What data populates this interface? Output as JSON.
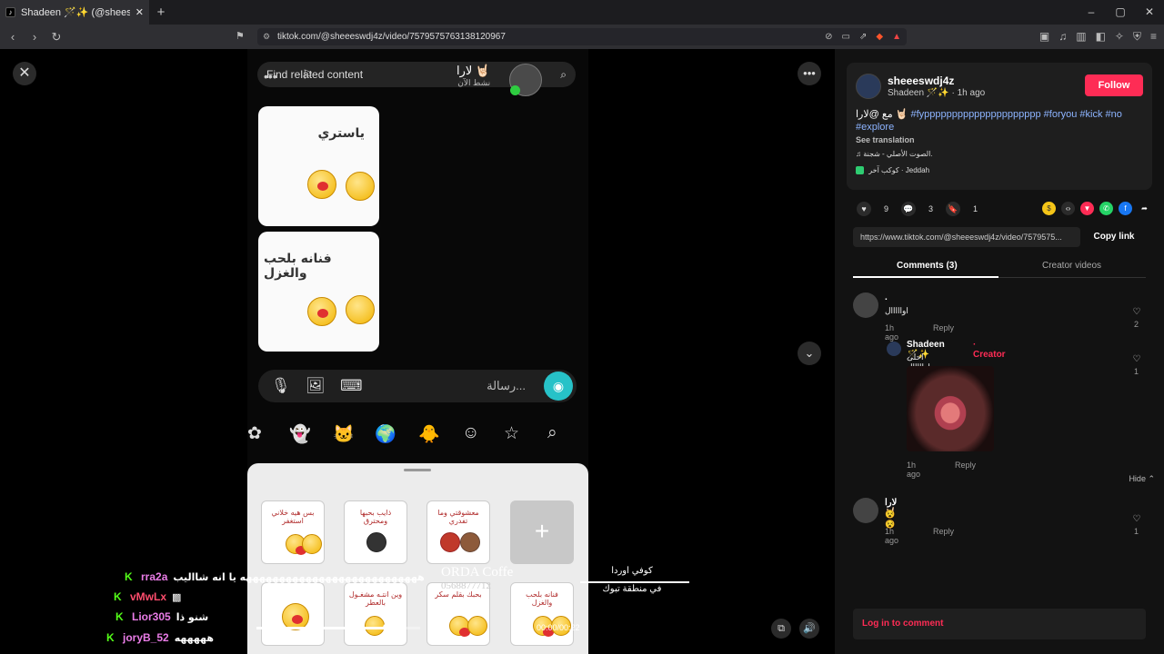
{
  "browser": {
    "tab_title": "Shadeen 🪄✨ (@sheeswd",
    "url": "tiktok.com/@sheeeswdj4z/video/7579575763138120967"
  },
  "video": {
    "search_placeholder": "Find related content",
    "chat_name": "لارا 🤘🏻",
    "chat_status": "نشط الآن",
    "stickers": [
      {
        "text": "ياستري"
      },
      {
        "text": "فنانه بلحب والغزل"
      }
    ],
    "composer_placeholder": "رسالة...",
    "tray_tiles": [
      {
        "text": "بس هيه خلاني استغفر"
      },
      {
        "text": "ذايب بحبها ومحترق"
      },
      {
        "text": "معشوقتي وما تفدري"
      },
      {
        "text": ""
      },
      {
        "text": "وين انتـه مشغـول بالعطر"
      },
      {
        "text": "بحبك بقلم سكر"
      },
      {
        "text": "فنانه بلحب والغزل"
      }
    ],
    "timestamp": "00:00/00:22",
    "progress": 0.8
  },
  "overlay": {
    "logo_title": "ORDA Coffe",
    "logo_sub": "0568877712",
    "ar_top": "كوفي اوردا",
    "ar_bottom": "في منطقة تبوك",
    "chat": [
      {
        "user": "rra2a",
        "msg": "هههههههههههههههههههههههههههه يا انه شااليب"
      },
      {
        "user": "vMwLx",
        "msg": ""
      },
      {
        "user": "Lior305",
        "msg": "شنو ذا"
      },
      {
        "user": "joryB_52",
        "msg": "هههههه"
      }
    ]
  },
  "panel": {
    "username": "sheeeswdj4z",
    "display_name": "Shadeen 🪄✨",
    "time_ago": "· 1h ago",
    "follow_label": "Follow",
    "desc_prefix": "مع @لارا 🤘🏻",
    "hashtags": "#fyppppppppppppppppppppp #foryou #kick #no #explore",
    "see_translation": "See translation",
    "music": "♫ الصوت الأصلي - شجنة.",
    "location": "كوكب آخر · Jeddah",
    "likes": "9",
    "comments_count": "3",
    "saves": "1",
    "link_text": "https://www.tiktok.com/@sheeeswdj4z/video/7579575...",
    "copy_link": "Copy link",
    "tab_comments": "Comments (3)",
    "tab_creator": "Creator videos",
    "comments": [
      {
        "name": ".",
        "text": "اوااااال",
        "meta": "1h ago",
        "reply": "Reply",
        "likes": "2"
      },
      {
        "name": "Shadeen 🪄✨",
        "creator": "· Creator",
        "text": "احلى اوااااال",
        "meta": "1h ago",
        "reply": "Reply",
        "likes": "1"
      },
      {
        "name": "لارا 🤘🏻",
        "text": "😵😵",
        "meta": "1h ago",
        "reply": "Reply",
        "likes": "1"
      }
    ],
    "hide": "Hide ⌃",
    "login": "Log in to comment"
  }
}
